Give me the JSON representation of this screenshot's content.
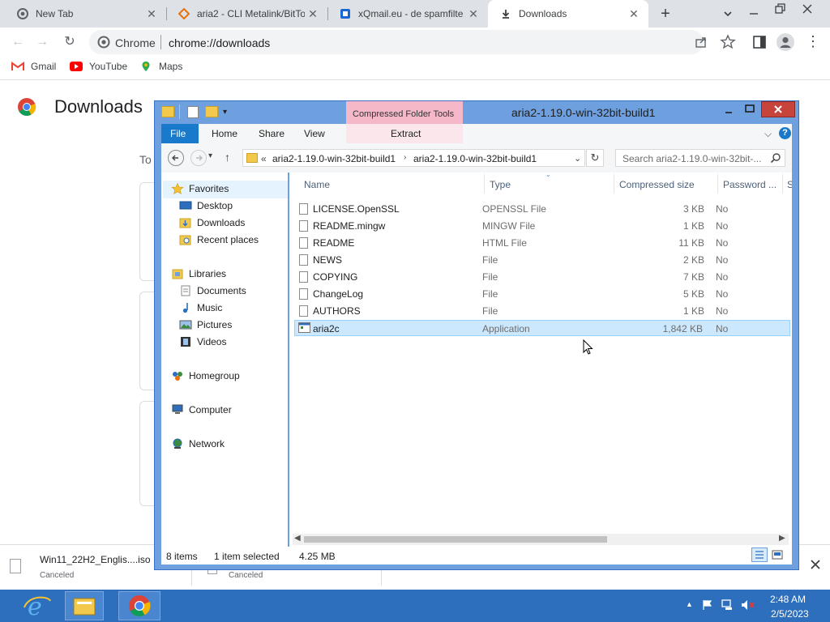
{
  "browser": {
    "tabs": [
      {
        "title": "New Tab",
        "icon": "chrome-icon"
      },
      {
        "title": "aria2 - CLI Metalink/BitTo",
        "icon": "aria2-icon"
      },
      {
        "title": "xQmail.eu - de spamfilte",
        "icon": "xqmail-icon"
      },
      {
        "title": "Downloads",
        "icon": "download-icon",
        "active": true
      }
    ],
    "new_tab_glyph": "+",
    "omnibox": {
      "site": "Chrome",
      "url": "chrome://downloads"
    },
    "bookmarks": [
      {
        "label": "Gmail",
        "icon": "gmail-icon"
      },
      {
        "label": "YouTube",
        "icon": "youtube-icon"
      },
      {
        "label": "Maps",
        "icon": "maps-icon"
      }
    ]
  },
  "downloads_page": {
    "title": "Downloads",
    "partial_text": "To",
    "bottom_items": [
      {
        "name": "Win11_22H2_Englis....iso",
        "status": "Canceled"
      },
      {
        "name": "",
        "status": "Canceled"
      }
    ]
  },
  "explorer": {
    "title": "aria2-1.19.0-win-32bit-build1",
    "contextual_tab": "Compressed Folder Tools",
    "ribbon_tabs": [
      "File",
      "Home",
      "Share",
      "View",
      "Extract"
    ],
    "breadcrumb": [
      "«",
      "aria2-1.19.0-win-32bit-build1",
      "aria2-1.19.0-win-32bit-build1"
    ],
    "search_placeholder": "Search aria2-1.19.0-win-32bit-...",
    "nav": {
      "favorites": {
        "label": "Favorites",
        "items": [
          "Desktop",
          "Downloads",
          "Recent places"
        ]
      },
      "libraries": {
        "label": "Libraries",
        "items": [
          "Documents",
          "Music",
          "Pictures",
          "Videos"
        ]
      },
      "homegroup": "Homegroup",
      "computer": "Computer",
      "network": "Network"
    },
    "columns": [
      "Name",
      "Type",
      "Compressed size",
      "Password ...",
      "Si"
    ],
    "files": [
      {
        "name": "LICENSE.OpenSSL",
        "type": "OPENSSL File",
        "size": "3 KB",
        "password": "No"
      },
      {
        "name": "README.mingw",
        "type": "MINGW File",
        "size": "1 KB",
        "password": "No"
      },
      {
        "name": "README",
        "type": "HTML File",
        "size": "11 KB",
        "password": "No"
      },
      {
        "name": "NEWS",
        "type": "File",
        "size": "2 KB",
        "password": "No"
      },
      {
        "name": "COPYING",
        "type": "File",
        "size": "7 KB",
        "password": "No"
      },
      {
        "name": "ChangeLog",
        "type": "File",
        "size": "5 KB",
        "password": "No"
      },
      {
        "name": "AUTHORS",
        "type": "File",
        "size": "1 KB",
        "password": "No"
      },
      {
        "name": "aria2c",
        "type": "Application",
        "size": "1,842 KB",
        "password": "No",
        "selected": true
      }
    ],
    "status": {
      "count": "8 items",
      "selection": "1 item selected",
      "size": "4.25 MB"
    }
  },
  "taskbar": {
    "apps": [
      "ie-icon",
      "file-explorer-icon",
      "chrome-icon"
    ],
    "time": "2:48 AM",
    "date": "2/5/2023"
  },
  "colors": {
    "accent": "#1a73e8",
    "window_border": "#6ea0e0",
    "selection": "#cce8ff",
    "contextual_tab": "#f4b8c8",
    "taskbar": "#2d6fbd"
  }
}
